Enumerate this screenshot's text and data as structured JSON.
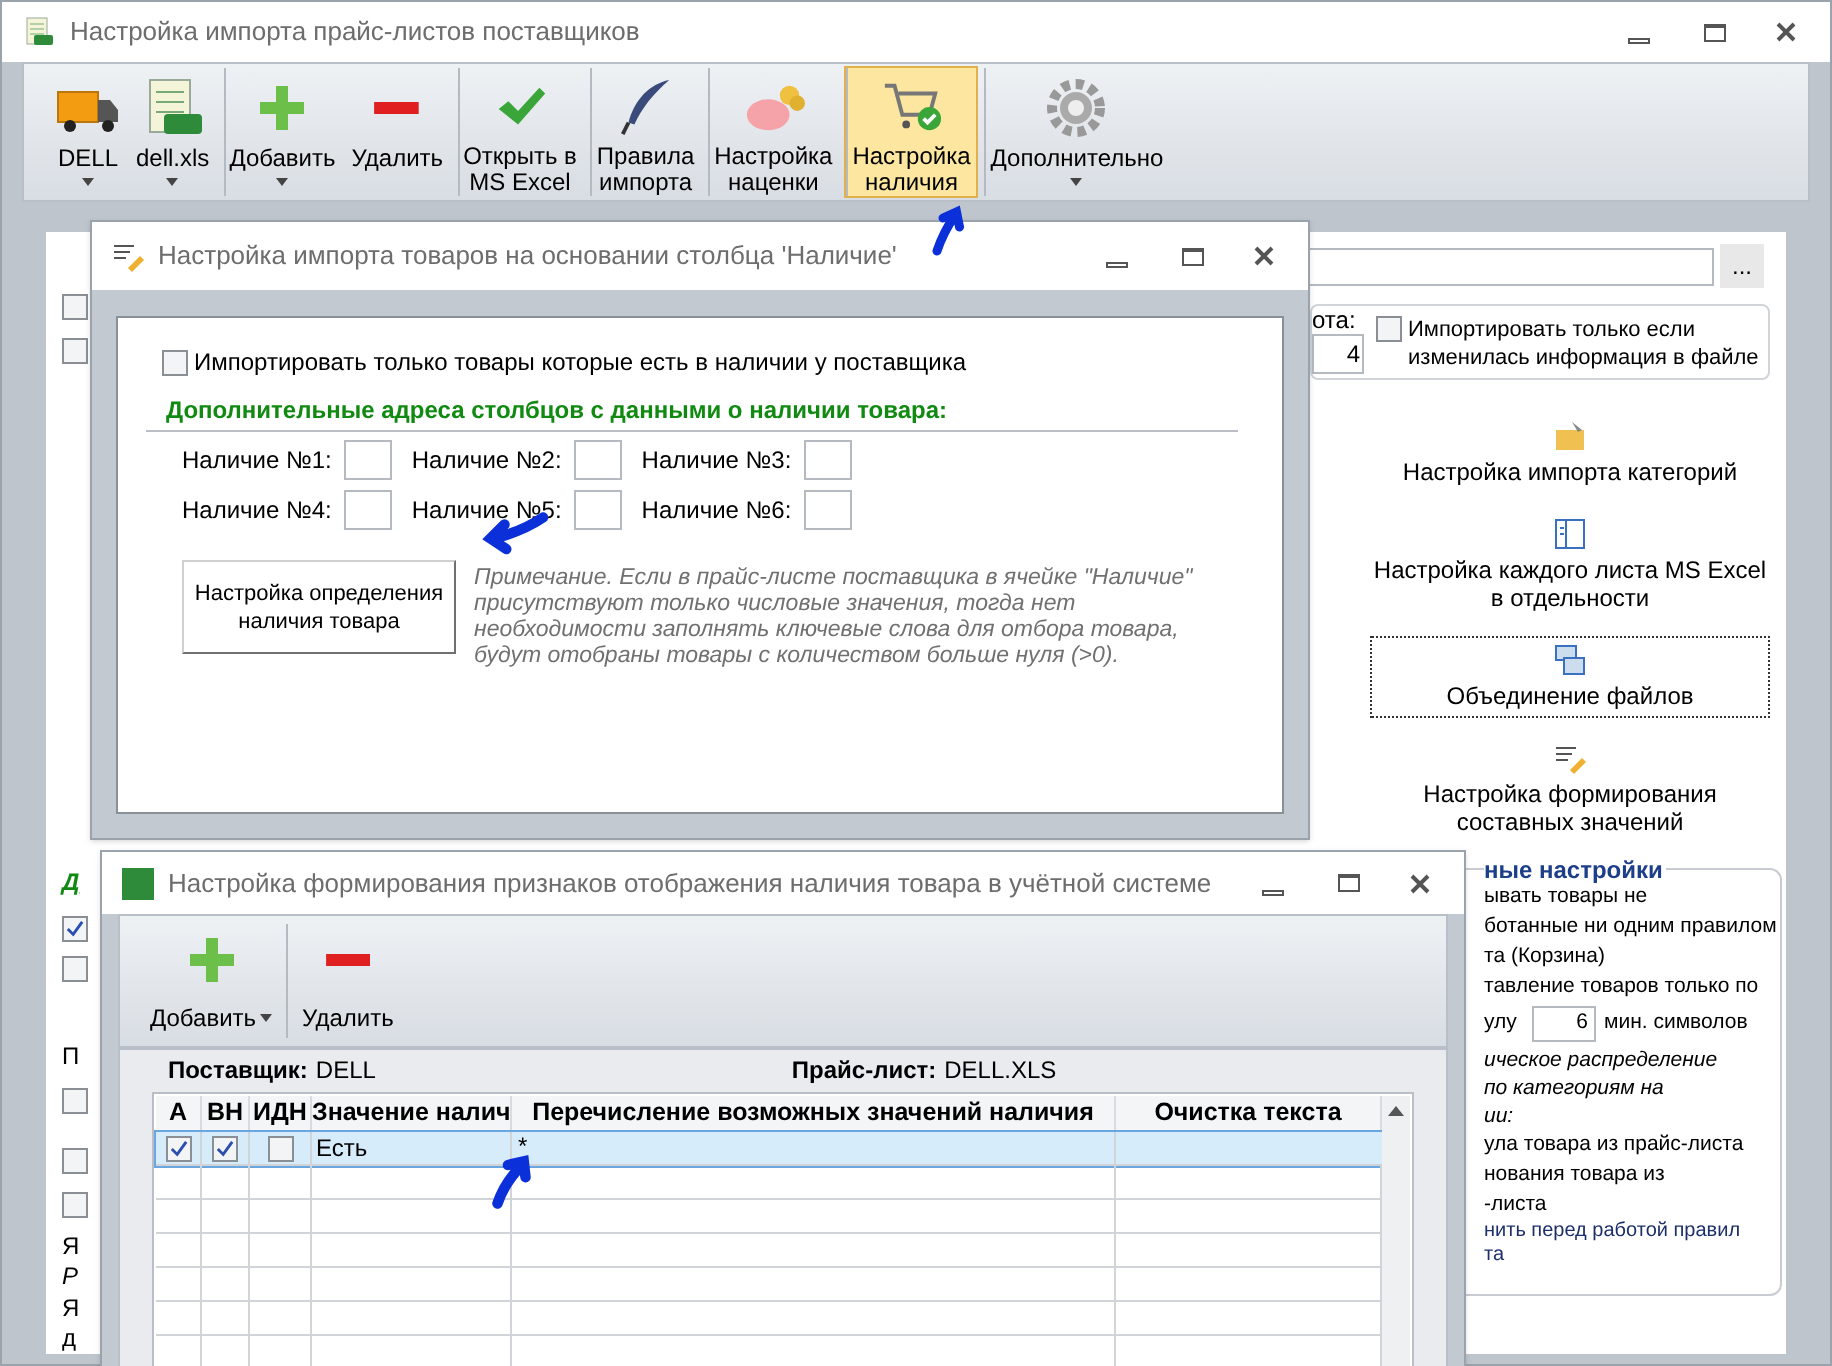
{
  "main_window": {
    "title": "Настройка импорта прайс-листов поставщиков"
  },
  "toolbar": [
    {
      "label": "DELL",
      "kind": "truck",
      "dropdown": true,
      "selected": false,
      "separator_before": false
    },
    {
      "label": "dell.xls",
      "kind": "xls",
      "dropdown": true,
      "selected": false,
      "separator_before": false
    },
    {
      "label": "Добавить",
      "kind": "add",
      "dropdown": true,
      "selected": false,
      "separator_before": true
    },
    {
      "label": "Удалить",
      "kind": "remove",
      "dropdown": false,
      "selected": false,
      "separator_before": false
    },
    {
      "label": "Открыть в\nMS Excel",
      "kind": "check",
      "dropdown": false,
      "selected": false,
      "separator_before": true
    },
    {
      "label": "Правила\nимпорта",
      "kind": "feather",
      "dropdown": false,
      "selected": false,
      "separator_before": true
    },
    {
      "label": "Настройка\nнаценки",
      "kind": "piggy",
      "dropdown": false,
      "selected": false,
      "separator_before": true
    },
    {
      "label": "Настройка\nналичия",
      "kind": "cart",
      "dropdown": false,
      "selected": true,
      "separator_before": true
    },
    {
      "label": "Дополнительно",
      "kind": "gear",
      "dropdown": true,
      "selected": false,
      "separator_before": true
    }
  ],
  "main_content": {
    "browse_button": "...",
    "period_label": "ота:",
    "period_value": "4",
    "only_changed": {
      "label": "Импортировать только если изменилась информация в файле",
      "checked": false
    },
    "left_top": [
      {
        "kind": "checkbox",
        "checked": false
      },
      {
        "kind": "checkbox",
        "checked": false
      }
    ],
    "left_bottom": [
      {
        "kind": "heading",
        "text": "Д"
      },
      {
        "kind": "checkbox",
        "checked": true
      },
      {
        "kind": "checkbox",
        "checked": false
      },
      {
        "kind": "text",
        "text": "П"
      },
      {
        "kind": "checkbox",
        "checked": false
      },
      {
        "kind": "checkbox",
        "checked": false
      },
      {
        "kind": "checkbox",
        "checked": false
      },
      {
        "kind": "text",
        "text": "Я"
      },
      {
        "kind": "italic",
        "text": "Р"
      },
      {
        "kind": "text",
        "text": "Я"
      },
      {
        "kind": "text",
        "text": "д"
      }
    ],
    "side_buttons": [
      {
        "label": "Настройка импорта категорий",
        "kind": "categories",
        "focused": false
      },
      {
        "label": "Настройка каждого листа MS Excel в отдельности",
        "kind": "sheets",
        "focused": false
      },
      {
        "label": "Объединение файлов",
        "kind": "merge",
        "focused": true
      },
      {
        "label": "Настройка формирования составных значений",
        "kind": "compose",
        "focused": false
      }
    ],
    "settings_group": {
      "title": "ные настройки",
      "lines": [
        {
          "kind": "text",
          "text": "ывать товары не"
        },
        {
          "kind": "text",
          "text": "ботанные ни одним правилом"
        },
        {
          "kind": "text",
          "text": "та (Корзина)"
        },
        {
          "kind": "text",
          "text": "тавление товаров только по"
        },
        {
          "kind": "input",
          "text": "улу",
          "value": "6",
          "suffix": "мин. символов"
        },
        {
          "kind": "italic",
          "text": "ическое распределение"
        },
        {
          "kind": "italic",
          "text": "по категориям на"
        },
        {
          "kind": "italic",
          "text": "ии:"
        },
        {
          "kind": "text",
          "text": "ула товара из прайс-листа"
        },
        {
          "kind": "text",
          "text": "нования товара из"
        },
        {
          "kind": "text",
          "text": "-листа"
        },
        {
          "kind": "small",
          "text": "нить перед работой правил"
        },
        {
          "kind": "small",
          "text": "та"
        }
      ]
    }
  },
  "availability_dialog": {
    "title": "Настройка импорта товаров на основании столбца 'Наличие'",
    "only_available": {
      "label": "Импортировать только товары которые есть в наличии у поставщика",
      "checked": false
    },
    "heading": "Дополнительные адреса столбцов с данными о наличии товара:",
    "columns": [
      {
        "label": "Наличие №1:"
      },
      {
        "label": "Наличие №2:"
      },
      {
        "label": "Наличие №3:"
      },
      {
        "label": "Наличие №4:"
      },
      {
        "label": "Наличие №5:"
      },
      {
        "label": "Наличие №6:"
      }
    ],
    "detect_button": "Настройка определения наличия товара",
    "note": "Примечание. Если в прайс-листе поставщика в ячейке \"Наличие\" присутствуют только числовые значения, тогда нет необходимости заполнять ключевые слова для отбора товара, будут отобраны товары с количеством больше нуля (>0)."
  },
  "signs_dialog": {
    "title": "Настройка формирования признаков отображения наличия товара в учётной системе",
    "toolbar": [
      {
        "label": "Добавить",
        "kind": "add",
        "dropdown": true
      },
      {
        "label": "Удалить",
        "kind": "remove",
        "dropdown": false
      }
    ],
    "supplier_label": "Поставщик:",
    "supplier": "DELL",
    "pricelist_label": "Прайс-лист:",
    "pricelist": "DELL.XLS",
    "grid": {
      "columns": [
        "А",
        "ВН",
        "ИДН",
        "Значение налич",
        "Перечисление возможных значений наличия",
        "Очистка текста"
      ],
      "rows": [
        {
          "a": true,
          "vn": true,
          "idn": false,
          "value": "Есть",
          "values_list": "*",
          "selected": true
        }
      ]
    }
  }
}
